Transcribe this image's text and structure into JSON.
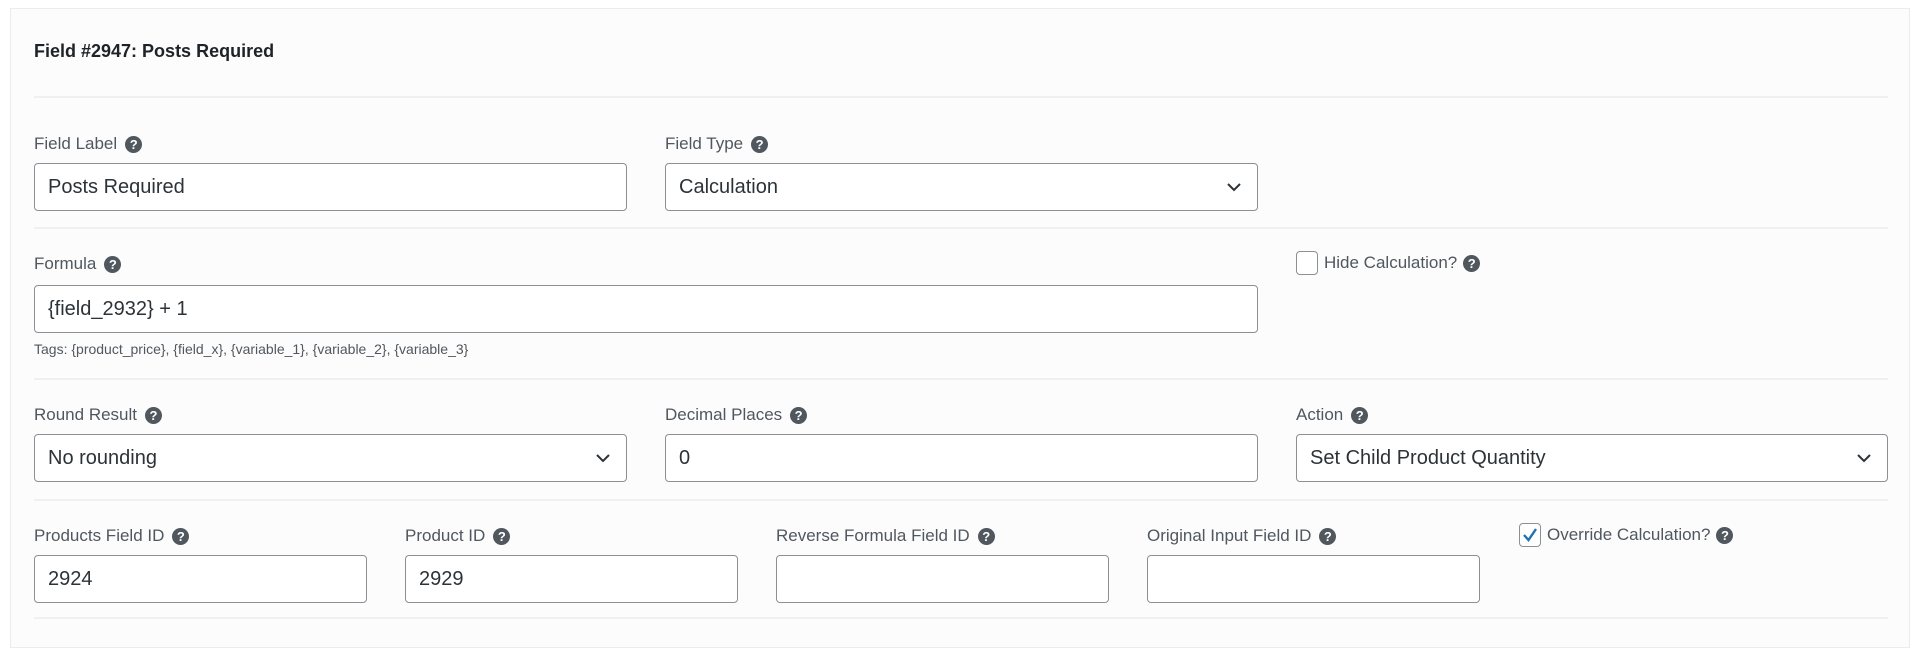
{
  "header": {
    "title": "Field #2947: Posts Required"
  },
  "help_glyph": "?",
  "fields": {
    "field_label": {
      "label": "Field Label",
      "value": "Posts Required"
    },
    "field_type": {
      "label": "Field Type",
      "value": "Calculation"
    },
    "formula": {
      "label": "Formula",
      "value": "{field_2932} + 1",
      "hint": "Tags: {product_price}, {field_x}, {variable_1}, {variable_2}, {variable_3}"
    },
    "hide_calculation": {
      "label": "Hide Calculation?",
      "checked": false
    },
    "round_result": {
      "label": "Round Result",
      "value": "No rounding"
    },
    "decimal_places": {
      "label": "Decimal Places",
      "value": "0"
    },
    "action": {
      "label": "Action",
      "value": "Set Child Product Quantity"
    },
    "products_field_id": {
      "label": "Products Field ID",
      "value": "2924"
    },
    "product_id": {
      "label": "Product ID",
      "value": "2929"
    },
    "reverse_formula_field_id": {
      "label": "Reverse Formula Field ID",
      "value": ""
    },
    "original_input_field_id": {
      "label": "Original Input Field ID",
      "value": ""
    },
    "override_calculation": {
      "label": "Override Calculation?",
      "checked": true
    }
  },
  "colors": {
    "checkmark": "#2271b1",
    "help_icon": "#50575e"
  }
}
